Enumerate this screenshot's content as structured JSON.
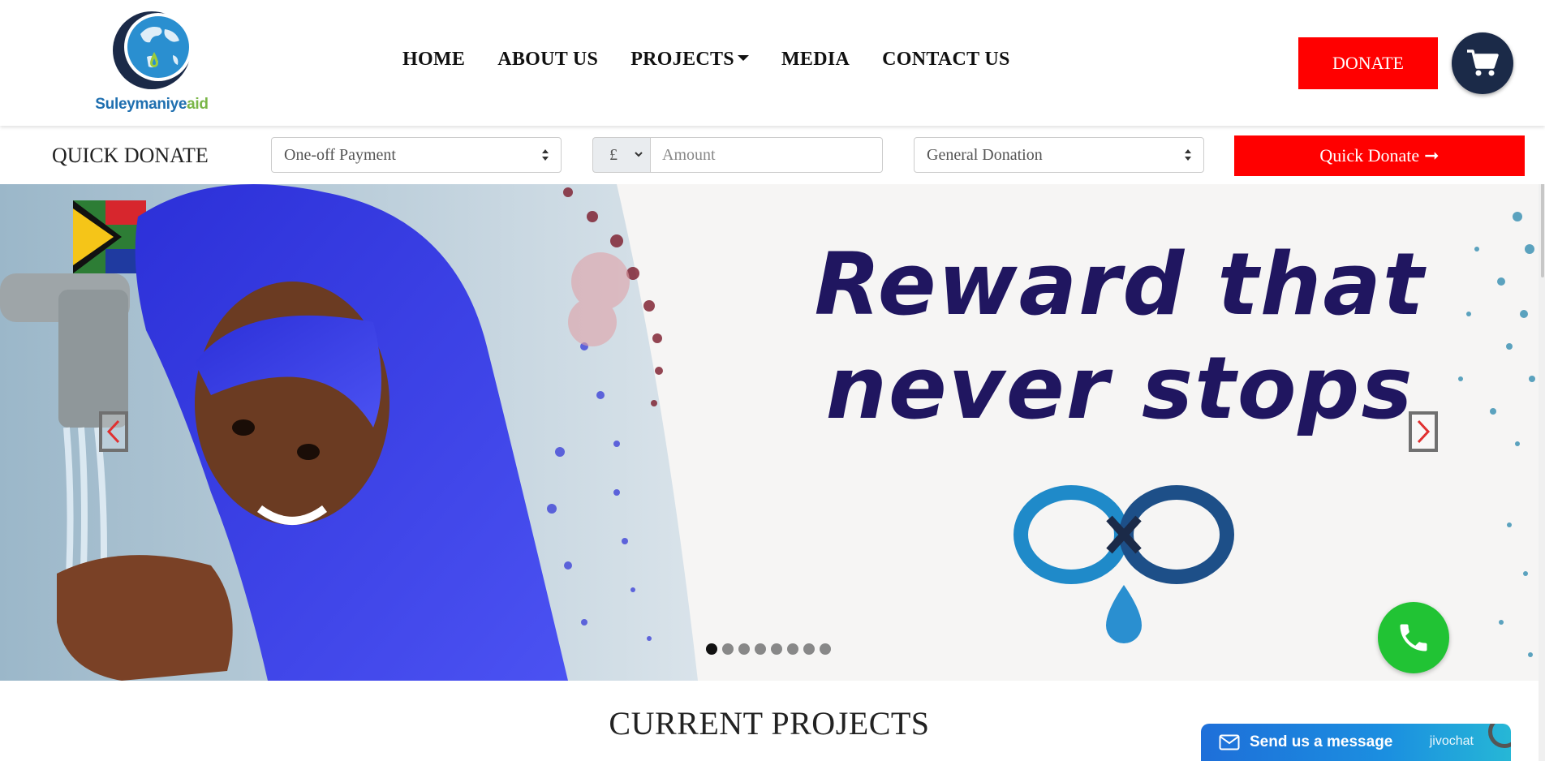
{
  "brand": {
    "name_part1": "Suleymaniye",
    "name_part2": "aid",
    "color_blue": "#1f6fb0",
    "color_green": "#7ab648"
  },
  "nav": {
    "items": [
      {
        "label": "HOME"
      },
      {
        "label": "ABOUT US"
      },
      {
        "label": "PROJECTS"
      },
      {
        "label": "MEDIA"
      },
      {
        "label": "CONTACT US"
      }
    ],
    "donate_label": "DONATE",
    "cart_icon": "shopping-cart-icon"
  },
  "quick_donate": {
    "label": "QUICK DONATE",
    "payment_type": "One-off Payment",
    "currency": "£",
    "amount_placeholder": "Amount",
    "category": "General Donation",
    "button_label": "Quick Donate",
    "button_arrow": "➞",
    "accent": "#ff0000"
  },
  "hero": {
    "headline_line1": "Reward that",
    "headline_line2": "never stops",
    "headline_color": "#201660",
    "slide_count": 8,
    "active_slide": 1
  },
  "section": {
    "title": "CURRENT PROJECTS"
  },
  "chat": {
    "label": "Send us a message",
    "brand": "jivochat"
  },
  "colors": {
    "navy": "#1b2a48",
    "call_green": "#21c334"
  }
}
